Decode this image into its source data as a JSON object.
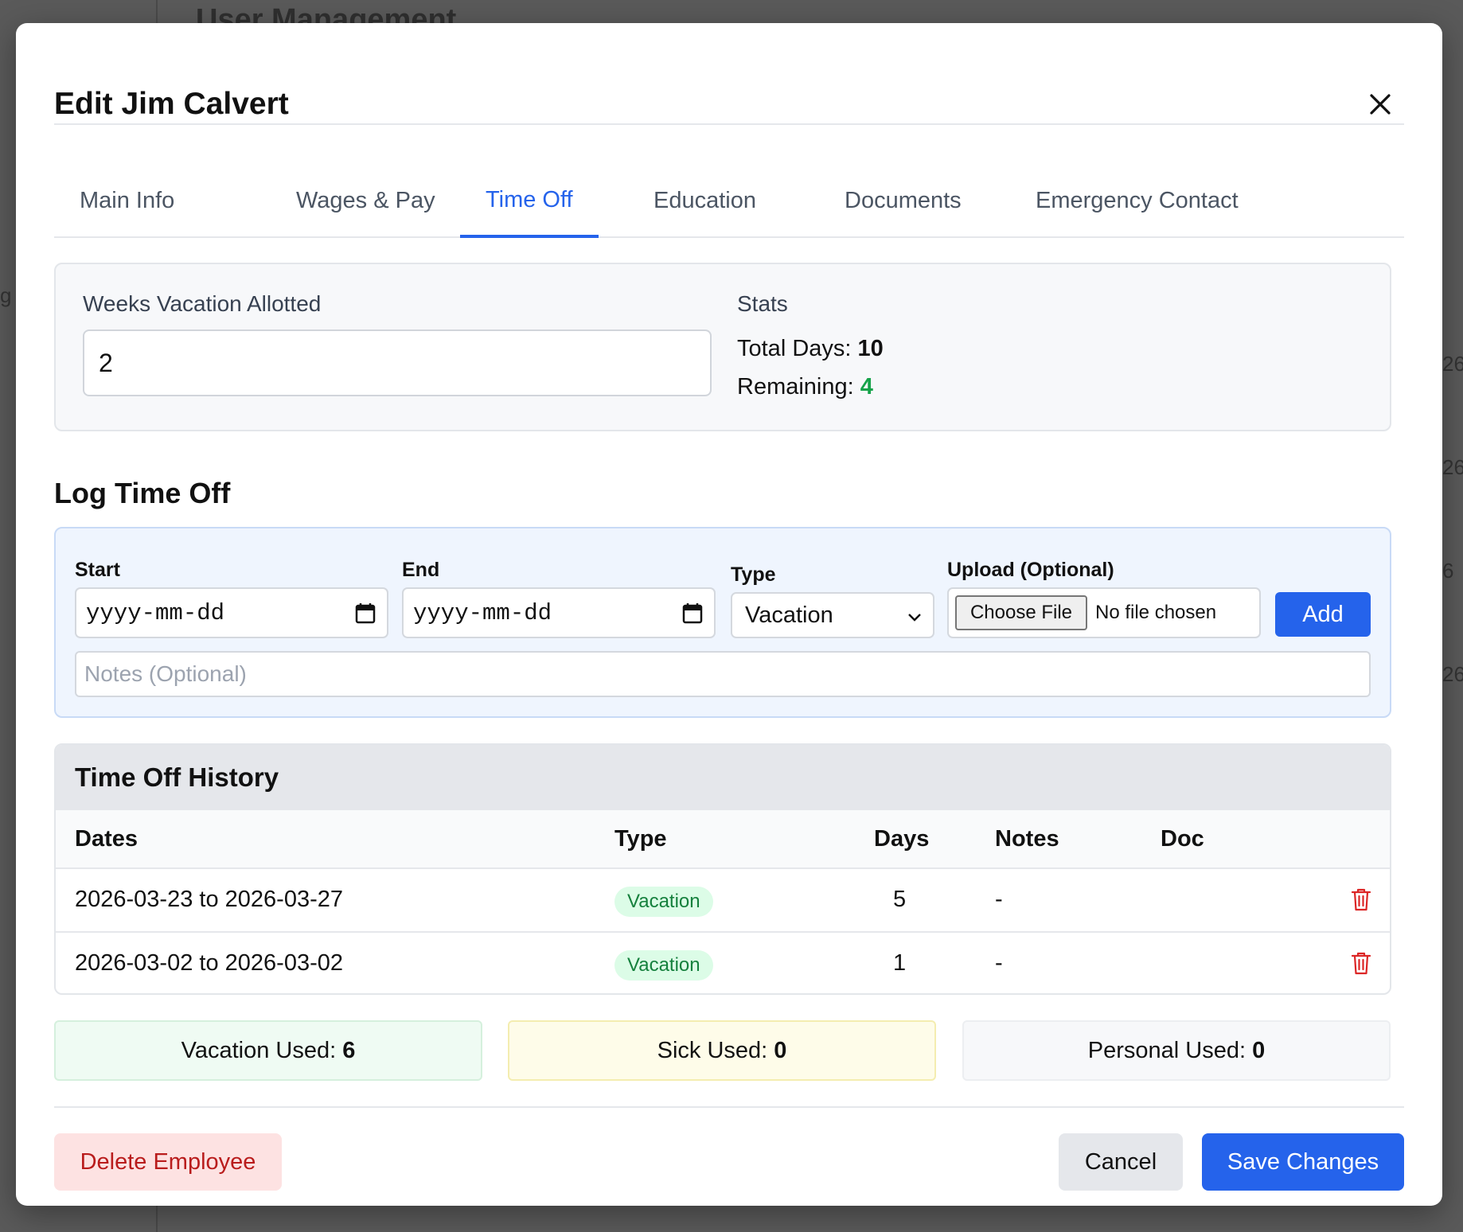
{
  "background": {
    "page_title": "User Management",
    "fragments": [
      "g",
      "26",
      "26",
      "6",
      "26"
    ]
  },
  "modal": {
    "title": "Edit Jim Calvert",
    "tabs": [
      {
        "label": "Main Info"
      },
      {
        "label": "Wages & Pay"
      },
      {
        "label": "Time Off"
      },
      {
        "label": "Education"
      },
      {
        "label": "Documents"
      },
      {
        "label": "Emergency Contact"
      }
    ],
    "active_tab": "Time Off"
  },
  "allotment": {
    "label": "Weeks Vacation Allotted",
    "value": "2",
    "stats_heading": "Stats",
    "total_label": "Total Days:",
    "total_value": "10",
    "remaining_label": "Remaining:",
    "remaining_value": "4"
  },
  "log": {
    "title": "Log Time Off",
    "start_label": "Start",
    "start_value": "yyyy-mm-dd",
    "end_label": "End",
    "end_value": "yyyy-mm-dd",
    "type_label": "Type",
    "type_value": "Vacation",
    "upload_label": "Upload (Optional)",
    "choose_file_label": "Choose File",
    "no_file_text": "No file chosen",
    "add_label": "Add",
    "notes_placeholder": "Notes (Optional)"
  },
  "history": {
    "title": "Time Off History",
    "columns": [
      "Dates",
      "Type",
      "Days",
      "Notes",
      "Doc"
    ],
    "rows": [
      {
        "dates": "2026-03-23 to 2026-03-27",
        "type": "Vacation",
        "days": "5",
        "notes": "-"
      },
      {
        "dates": "2026-03-02 to 2026-03-02",
        "type": "Vacation",
        "days": "1",
        "notes": "-"
      }
    ]
  },
  "summary": {
    "vacation_label": "Vacation Used:",
    "vacation_value": "6",
    "sick_label": "Sick Used:",
    "sick_value": "0",
    "personal_label": "Personal Used:",
    "personal_value": "0"
  },
  "footer": {
    "delete_label": "Delete Employee",
    "cancel_label": "Cancel",
    "save_label": "Save Changes"
  },
  "colors": {
    "accent": "#2563eb",
    "danger": "#dc2626",
    "success": "#16a34a"
  }
}
